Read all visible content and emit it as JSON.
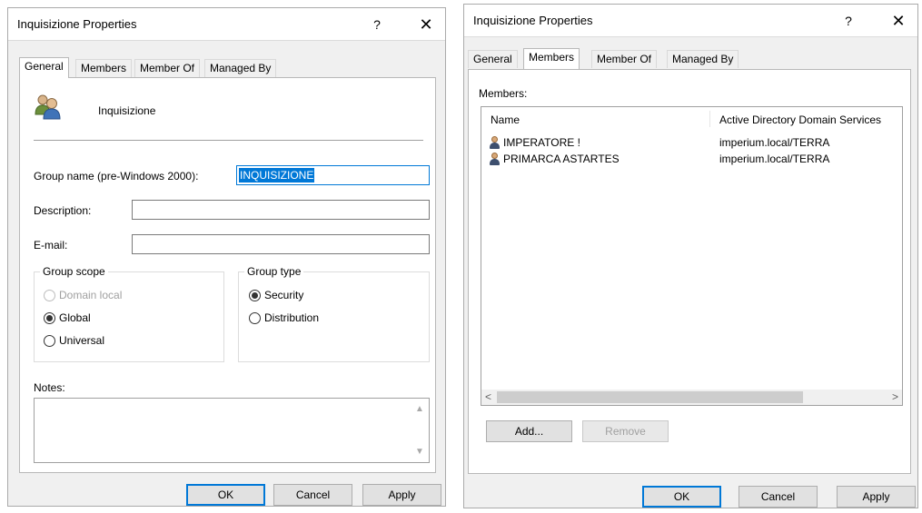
{
  "left_dialog": {
    "title": "Inquisizione Properties",
    "help": "?",
    "close": "✕",
    "tabs": [
      "General",
      "Members",
      "Member Of",
      "Managed By"
    ],
    "group_display_name": "Inquisizione",
    "group_name_label": "Group name (pre-Windows 2000):",
    "group_name_value": "INQUISIZIONE",
    "description_label": "Description:",
    "description_value": "",
    "email_label": "E-mail:",
    "email_value": "",
    "group_scope": {
      "legend": "Group scope",
      "options": [
        "Domain local",
        "Global",
        "Universal"
      ],
      "selected": "Global"
    },
    "group_type": {
      "legend": "Group type",
      "options": [
        "Security",
        "Distribution"
      ],
      "selected": "Security"
    },
    "notes_label": "Notes:",
    "notes_value": "",
    "buttons": {
      "ok": "OK",
      "cancel": "Cancel",
      "apply": "Apply"
    }
  },
  "right_dialog": {
    "title": "Inquisizione Properties",
    "help": "?",
    "close": "✕",
    "tabs": [
      "General",
      "Members",
      "Member Of",
      "Managed By"
    ],
    "members_label": "Members:",
    "columns": [
      "Name",
      "Active Directory Domain Services"
    ],
    "members": [
      {
        "name": "IMPERATORE !",
        "folder": "imperium.local/TERRA"
      },
      {
        "name": "PRIMARCA ASTARTES",
        "folder": "imperium.local/TERRA"
      }
    ],
    "scroll_left": "<",
    "scroll_right": ">",
    "add_button": "Add...",
    "remove_button": "Remove",
    "buttons": {
      "ok": "OK",
      "cancel": "Cancel",
      "apply": "Apply"
    }
  },
  "colors": {
    "accent": "#0078d7",
    "dialog_bg": "#f0f0f0"
  },
  "icons": {
    "group": "group-icon",
    "user": "user-icon"
  }
}
